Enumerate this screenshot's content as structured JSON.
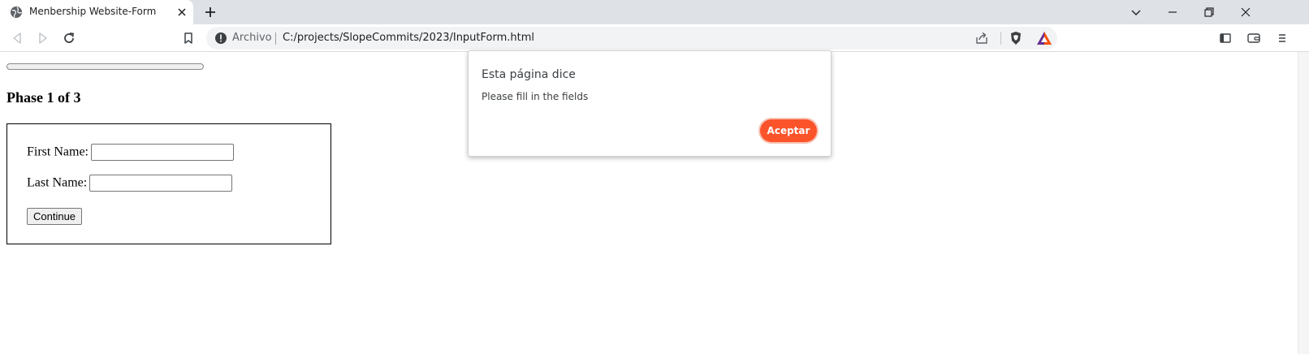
{
  "tab": {
    "title": "Menbership Website-Form",
    "favicon": "globe-icon"
  },
  "window_controls": [
    "chevron-down-icon",
    "minimize-icon",
    "restore-icon",
    "close-icon"
  ],
  "toolbar": {
    "icons": [
      "back-icon",
      "forward-icon",
      "reload-icon",
      "bookmark-icon",
      "sidebar-icon",
      "wallet-icon",
      "menu-icon"
    ]
  },
  "omnibox": {
    "security_label": "Archivo",
    "url": "C:/projects/SlopeCommits/2023/InputForm.html"
  },
  "page": {
    "progress_value": 0,
    "phase_heading": "Phase 1 of 3",
    "form": {
      "first_name_label": "First Name:",
      "first_name_value": "",
      "last_name_label": "Last Name:",
      "last_name_value": "",
      "continue_label": "Continue"
    }
  },
  "dialog": {
    "title": "Esta página dice",
    "message": "Please fill in the fields",
    "ok_label": "Aceptar"
  },
  "colors": {
    "accent": "#fb542b",
    "tabstrip": "#dee1e6",
    "omnibox": "#f1f3f4"
  }
}
